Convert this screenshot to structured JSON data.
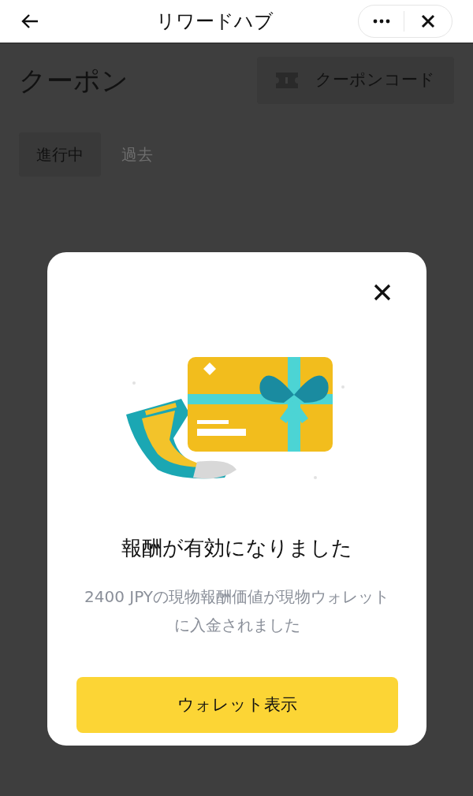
{
  "header": {
    "title": "リワードハブ"
  },
  "page": {
    "title": "クーポン",
    "code_button": "クーポンコード"
  },
  "tabs": [
    {
      "label": "進行中",
      "selected": true
    },
    {
      "label": "過去",
      "selected": false
    }
  ],
  "dialog": {
    "title": "報酬が有効になりました",
    "message": "2400 JPYの現物報酬価値が現物ウォレットに入金されました",
    "button": "ウォレット表示"
  }
}
